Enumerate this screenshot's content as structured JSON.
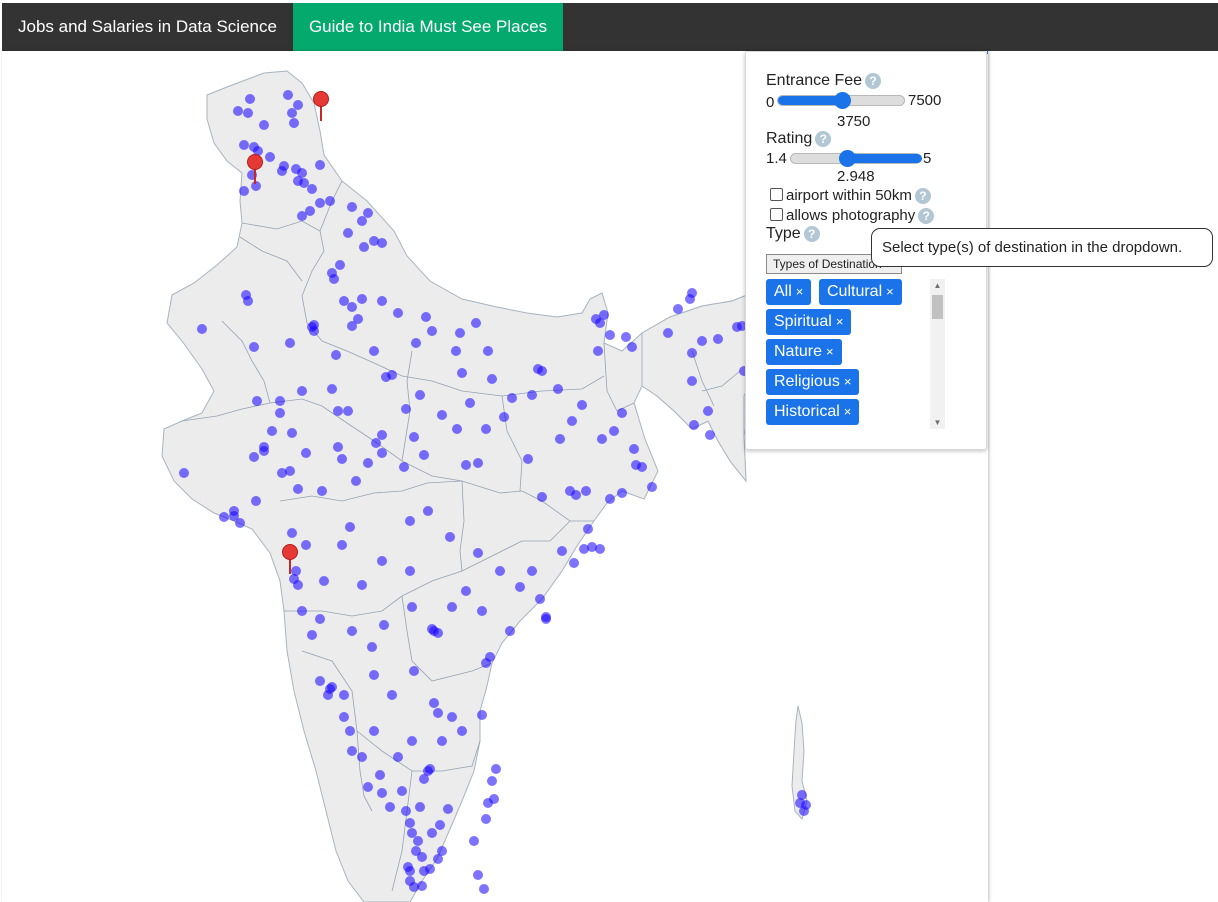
{
  "nav": {
    "tabs": [
      {
        "label": "Jobs and Salaries in Data Science",
        "active": false
      },
      {
        "label": "Guide to India Must See Places",
        "active": true
      }
    ]
  },
  "colors": {
    "nav_bg": "#333333",
    "nav_active": "#04AA6D",
    "accent": "#1a73e8",
    "map_fill": "#ececed",
    "point_color": "#1400ff",
    "marker_red": "#e53935"
  },
  "controls": {
    "entrance_fee": {
      "label": "Entrance Fee",
      "min": "0",
      "max": "7500",
      "value": "3750",
      "fraction": 0.5
    },
    "rating": {
      "label": "Rating",
      "min": "1.4",
      "max": "5",
      "value": "2.948",
      "low_fraction": 0.43,
      "high_fraction": 1.0
    },
    "airport": {
      "label": "airport within 50km",
      "checked": false
    },
    "photography": {
      "label": "allows photography",
      "checked": false
    },
    "type": {
      "label": "Type",
      "button_label": "Types of Destination",
      "selected": [
        {
          "label": "All",
          "remove": "×"
        },
        {
          "label": "Cultural",
          "remove": "×"
        },
        {
          "label": "Spiritual",
          "remove": "×"
        },
        {
          "label": "Nature",
          "remove": "×"
        },
        {
          "label": "Religious",
          "remove": "×"
        },
        {
          "label": "Historical",
          "remove": "×"
        }
      ]
    },
    "help_icon": "question-circle-icon",
    "help_glyph": "?"
  },
  "tooltip": {
    "text": "Select type(s) of destination in the dropdown."
  },
  "map": {
    "region": "India",
    "marker_icon": "map-pin-icon",
    "pin_count": 3,
    "point_count": 260
  }
}
